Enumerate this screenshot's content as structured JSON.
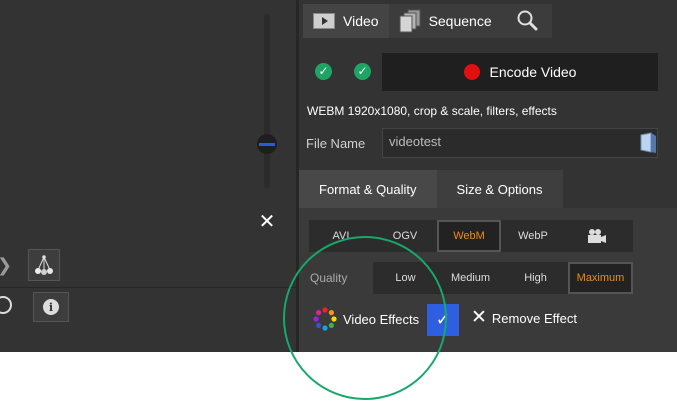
{
  "tabs": [
    {
      "label": "Video",
      "icon": "play-icon"
    },
    {
      "label": "Sequence",
      "icon": "sequence-icon"
    },
    {
      "label": "",
      "icon": "search-icon"
    }
  ],
  "encode": {
    "label": "Encode Video",
    "status_colors": {
      "check": "#1fa563",
      "record": "#e01010"
    }
  },
  "summary": "WEBM 1920x1080, crop & scale, filters, effects",
  "file_name": {
    "label": "File Name",
    "value": "videotest"
  },
  "subtabs": [
    "Format & Quality",
    "Size & Options"
  ],
  "formats": {
    "items": [
      "AVI",
      "OGV",
      "WebM",
      "WebP",
      ""
    ],
    "selected": "WebM",
    "last_icon": "camera-icon"
  },
  "quality": {
    "label": "Quality",
    "options": [
      "Low",
      "Medium",
      "High",
      "Maximum"
    ],
    "selected": "Maximum"
  },
  "effects": {
    "label": "Video Effects",
    "remove_label": "Remove Effect",
    "checked": true
  },
  "left_panel": {
    "close_glyph": "✕",
    "chevron_glyph": "❯",
    "info_glyph": "i"
  },
  "colors": {
    "accent_orange": "#f08b1a",
    "toggle_blue": "#2d5fe0",
    "annotation_green": "#17a86a"
  }
}
